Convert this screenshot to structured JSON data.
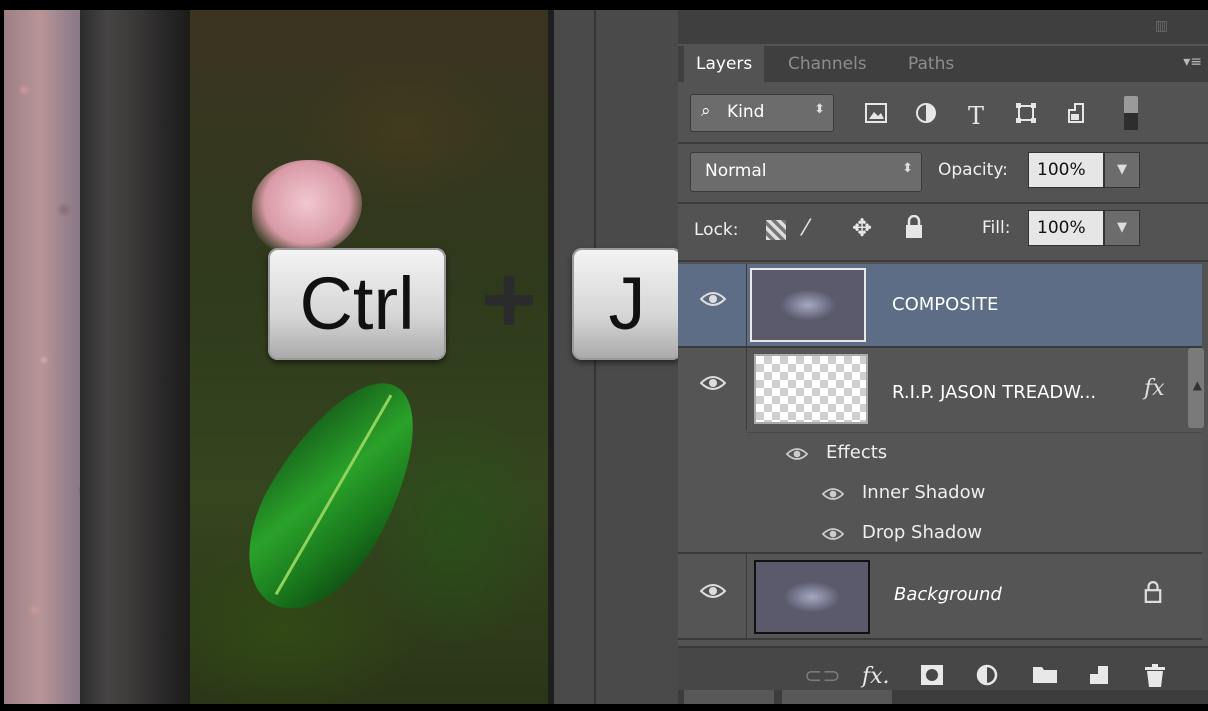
{
  "overlay": {
    "key1": "Ctrl",
    "plus": "+",
    "key2": "J"
  },
  "panel": {
    "tabs": [
      "Layers",
      "Channels",
      "Paths"
    ],
    "active_tab": "Layers",
    "filter": {
      "label": "Kind",
      "search_glyph": "⌕",
      "arrow": "⬍"
    },
    "blend_mode": "Normal",
    "opacity": {
      "label": "Opacity:",
      "value": "100%"
    },
    "lock": {
      "label": "Lock:"
    },
    "fill": {
      "label": "Fill:",
      "value": "100%"
    }
  },
  "layers": [
    {
      "name": "COMPOSITE",
      "selected": true
    },
    {
      "name": "R.I.P. JASON  TREADW...",
      "fx": "fx",
      "effects_label": "Effects",
      "effects": [
        "Inner Shadow",
        "Drop Shadow"
      ]
    },
    {
      "name": "Background",
      "locked": true
    }
  ],
  "icons": {
    "eye": "👁",
    "filter_image": "image-filter-icon",
    "filter_adjust": "adjustment-filter-icon",
    "filter_type": "T",
    "filter_shape": "shape-filter-icon",
    "filter_smart": "smart-object-filter-icon",
    "lock_transparent": "lock-transparent-icon",
    "lock_paint": "lock-paint-icon",
    "lock_move": "lock-position-icon",
    "lock_all": "lock-all-icon"
  },
  "colors": {
    "panel_bg": "#535353",
    "selected_layer": "#5d6d86",
    "tab_bar": "#3f3f3f"
  }
}
